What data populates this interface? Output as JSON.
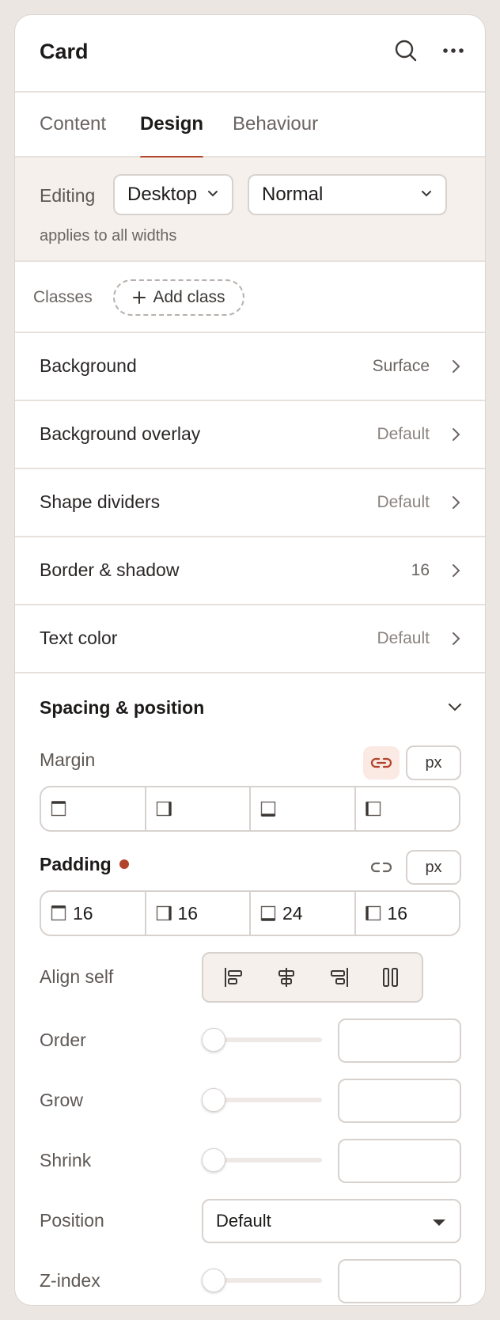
{
  "header": {
    "title": "Card",
    "search_icon": "search-icon",
    "more_icon": "more-horizontal-icon"
  },
  "tabs": [
    {
      "label": "Content",
      "active": false
    },
    {
      "label": "Design",
      "active": true
    },
    {
      "label": "Behaviour",
      "active": false
    }
  ],
  "editing": {
    "label": "Editing",
    "device": "Desktop",
    "state": "Normal",
    "note": "applies to all widths"
  },
  "classes": {
    "label": "Classes",
    "add_label": "Add class"
  },
  "rows": [
    {
      "label": "Background",
      "value": "Surface"
    },
    {
      "label": "Background overlay",
      "value": "Default"
    },
    {
      "label": "Shape dividers",
      "value": "Default"
    },
    {
      "label": "Border & shadow",
      "value": "16"
    },
    {
      "label": "Text color",
      "value": "Default"
    }
  ],
  "spacing": {
    "title": "Spacing & position",
    "margin": {
      "label": "Margin",
      "unit": "px",
      "linked": true,
      "top": "",
      "right": "",
      "bottom": "",
      "left": ""
    },
    "padding": {
      "label": "Padding",
      "unit": "px",
      "linked": false,
      "modified": true,
      "top": "16",
      "right": "16",
      "bottom": "24",
      "left": "16"
    },
    "align_self": {
      "label": "Align self"
    },
    "order": {
      "label": "Order",
      "value": ""
    },
    "grow": {
      "label": "Grow",
      "value": ""
    },
    "shrink": {
      "label": "Shrink",
      "value": ""
    },
    "position": {
      "label": "Position",
      "value": "Default"
    },
    "z_index": {
      "label": "Z-index",
      "value": ""
    }
  },
  "colors": {
    "accent": "#b3442c",
    "editing_bg": "#f5f0ec",
    "link_active_bg": "#fbe9e3"
  }
}
